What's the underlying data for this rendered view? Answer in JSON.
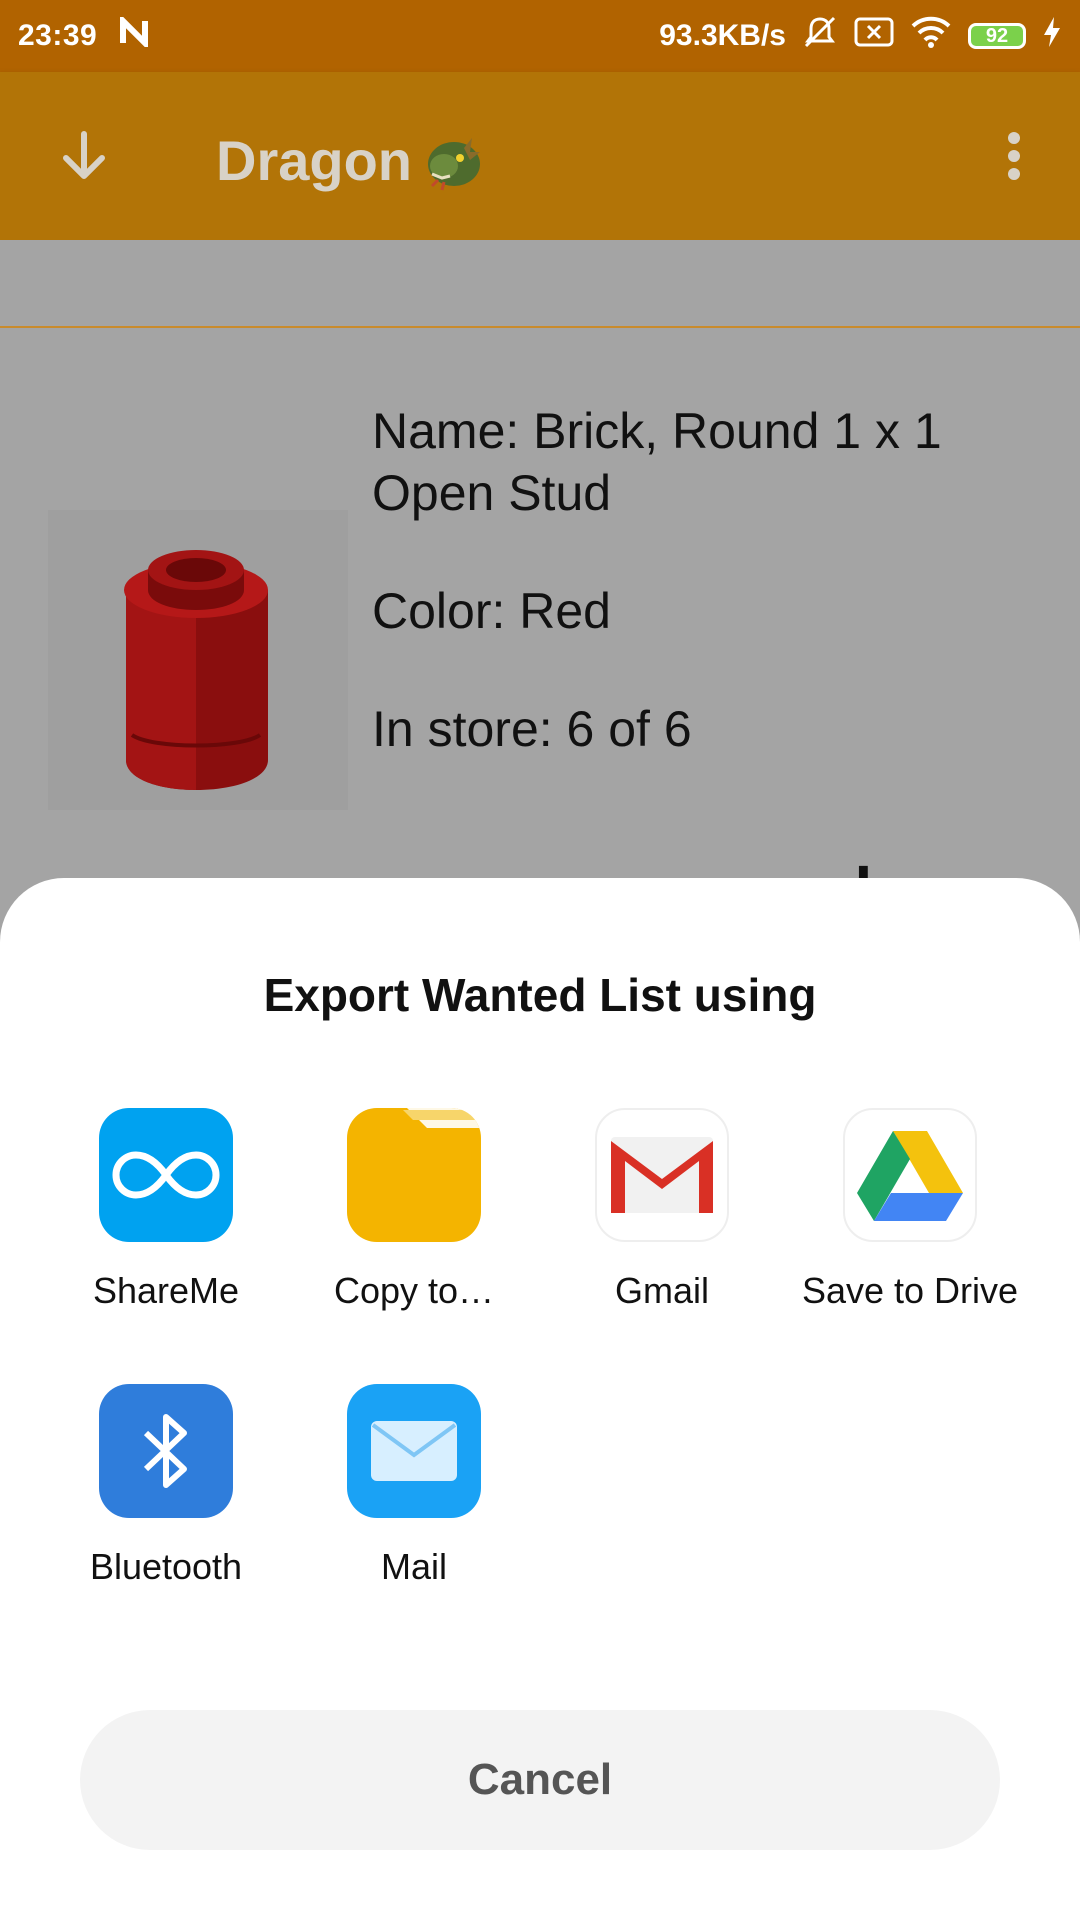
{
  "status_bar": {
    "time": "23:39",
    "network_speed": "93.3KB/s",
    "battery_level": "92",
    "icons": [
      "notification-n-icon",
      "mute-icon",
      "sim-off-icon",
      "wifi-icon",
      "battery-icon",
      "charging-icon"
    ]
  },
  "app_bar": {
    "title": "Dragon",
    "title_icon": "dragon-emoji-icon",
    "nav_icon": "arrow-down-icon",
    "menu_icon": "more-vert-icon",
    "color": "#b27407"
  },
  "part": {
    "name": "Name: Brick, Round 1 x 1 Open Stud",
    "color": "Color: Red",
    "stock": "In store: 6 of 6",
    "minus_label": "-",
    "plus_label": "+",
    "image": "red-round-brick-icon"
  },
  "share_sheet": {
    "title": "Export Wanted List using",
    "apps": [
      {
        "label": "ShareMe",
        "icon": "shareme-icon"
      },
      {
        "label": "Copy to…",
        "icon": "folder-icon"
      },
      {
        "label": "Gmail",
        "icon": "gmail-icon"
      },
      {
        "label": "Save to Drive",
        "icon": "google-drive-icon"
      },
      {
        "label": "Bluetooth",
        "icon": "bluetooth-icon"
      },
      {
        "label": "Mail",
        "icon": "mail-icon"
      }
    ],
    "cancel_label": "Cancel"
  },
  "colors": {
    "status_bar": "#b16300",
    "app_bar": "#b27407",
    "scrim_content": "#a4a4a4",
    "shareme_blue": "#00a2f0",
    "folder_yellow": "#f4b400",
    "bluetooth_blue": "#2f7ddb",
    "mail_blue": "#1aa2f5"
  }
}
